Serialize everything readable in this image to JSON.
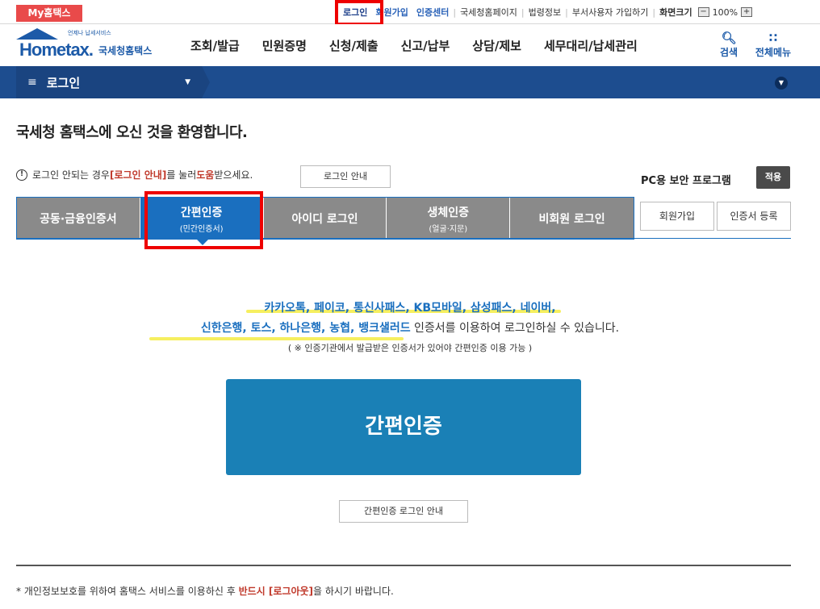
{
  "topbar": {
    "my_label": "My홈택스",
    "links": {
      "login": "로그인",
      "join": "회원가입",
      "cert": "인증센터",
      "nts": "국세청홈페이지",
      "law": "법령정보",
      "dept": "부서사용자 가입하기",
      "zoom_label": "화면크기",
      "zoom_minus": "−",
      "zoom_value": "100%",
      "zoom_plus": "+"
    }
  },
  "header": {
    "logo_text": "Hometax.",
    "logo_sub": "언제나 납세서비스",
    "logo_kr": "국세청홈택스",
    "nav": [
      "조회/발급",
      "민원증명",
      "신청/제출",
      "신고/납부",
      "상담/제보",
      "세무대리/납세관리"
    ],
    "search_label": "검색",
    "menu_label": "전체메뉴"
  },
  "band": {
    "label": "로그인"
  },
  "welcome": "국세청 홈택스에 오신 것을 환영합니다.",
  "notice": {
    "prefix": "로그인 안되는 경우 ",
    "link": "[로그인 안내]",
    "mid": "를 눌러 ",
    "help": "도움",
    "suffix": "받으세요.",
    "button": "로그인 안내"
  },
  "pc_security": {
    "label": "PC용 보안 프로그램",
    "button": "적용"
  },
  "tabs": [
    {
      "label": "공동·금융인증서",
      "sub": ""
    },
    {
      "label": "간편인증",
      "sub": "(민간인증서)"
    },
    {
      "label": "아이디 로그인",
      "sub": ""
    },
    {
      "label": "생체인증",
      "sub": "(얼굴·지문)"
    },
    {
      "label": "비회원 로그인",
      "sub": ""
    }
  ],
  "side_buttons": {
    "join": "회원가입",
    "cert": "인증서 등록"
  },
  "content": {
    "line1": "카카오톡, 페이코, 통신사패스, KB모바일, 삼성패스, 네이버,",
    "line2_blue": "신한은행, 토스, 하나은행, 농협, 뱅크샐러드",
    "line2_plain": " 인증서를 이용하여 로그인하실 수 있습니다.",
    "note": "( ※ 인증기관에서 발급받은 인증서가 있어야 간편인증 이용 가능 )",
    "big_button": "간편인증",
    "guide_button": "간편인증 로그인 안내"
  },
  "footer": {
    "prefix": "* 개인정보보호를 위하여 홈택스 서비스를 이용하신 후 ",
    "red": "반드시 [로그아웃]",
    "suffix": "을 하시기 바랍니다."
  },
  "colors": {
    "accent": "#1a6fbf",
    "band": "#1d4d8f",
    "red": "#e94a4a",
    "highlight": "#ee0000"
  }
}
